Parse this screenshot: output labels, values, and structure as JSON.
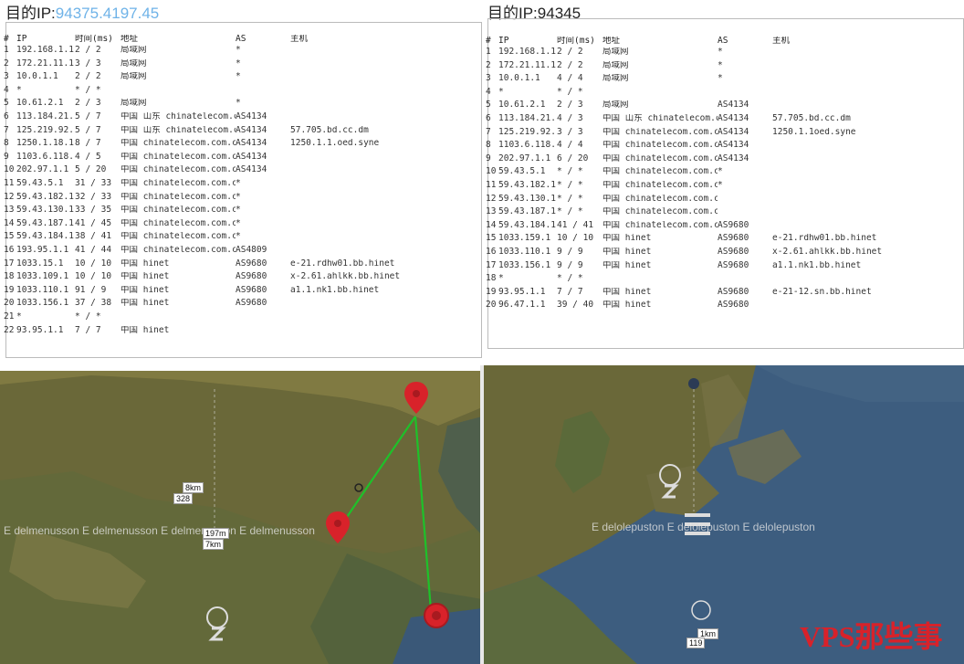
{
  "left": {
    "title_prefix": "目的IP:",
    "title_ip": "94375.4197.45",
    "headers": [
      "#",
      "IP",
      "时间(ms)",
      "地址",
      "AS",
      "主机"
    ],
    "rows": [
      [
        "1",
        "192.168.1.1",
        "2 / 2",
        "局域网",
        "*",
        ""
      ],
      [
        "2",
        "172.21.11.1",
        "3 / 3",
        "局域网",
        "*",
        ""
      ],
      [
        "3",
        "10.0.1.1",
        "2 / 2",
        "局域网",
        "*",
        ""
      ],
      [
        "4",
        "*",
        "* / *",
        "",
        "",
        ""
      ],
      [
        "5",
        "10.61.2.1",
        "2 / 3",
        "局域网",
        "*",
        ""
      ],
      [
        "6",
        "113.184.21.1",
        "5 / 7",
        "中国 山东 chinatelecom.com.cn",
        "AS4134",
        ""
      ],
      [
        "7",
        "125.219.92.1",
        "5 / 7",
        "中国 山东 chinatelecom.com.cn",
        "AS4134",
        "57.705.bd.cc.dm"
      ],
      [
        "8",
        "1250.1.18.1",
        "8 / 7",
        "中国 chinatelecom.com.cn",
        "AS4134",
        "1250.1.1.oed.syne"
      ],
      [
        "9",
        "1103.6.118.1",
        "4 / 5",
        "中国 chinatelecom.com.cn",
        "AS4134",
        ""
      ],
      [
        "10",
        "202.97.1.1",
        "5 / 20",
        "中国 chinatelecom.com.cn",
        "AS4134",
        ""
      ],
      [
        "11",
        "59.43.5.1",
        "31 / 33",
        "中国 chinatelecom.com.cn",
        "*",
        ""
      ],
      [
        "12",
        "59.43.182.1",
        "32 / 33",
        "中国 chinatelecom.com.cn",
        "*",
        ""
      ],
      [
        "13",
        "59.43.130.1",
        "33 / 35",
        "中国 chinatelecom.com.cn",
        "*",
        ""
      ],
      [
        "14",
        "59.43.187.1",
        "41 / 45",
        "中国 chinatelecom.com.cn",
        "*",
        ""
      ],
      [
        "15",
        "59.43.184.1",
        "38 / 41",
        "中国 chinatelecom.com.cn",
        "*",
        ""
      ],
      [
        "16",
        "193.95.1.1",
        "41 / 44",
        "中国 chinatelecom.com.cn",
        "AS4809",
        ""
      ],
      [
        "17",
        "1033.15.1",
        "10 / 10",
        "中国 hinet",
        "AS9680",
        "e-21.rdhw01.bb.hinet"
      ],
      [
        "18",
        "1033.109.1",
        "10 / 10",
        "中国 hinet",
        "AS9680",
        "x-2.61.ahlkk.bb.hinet"
      ],
      [
        "19",
        "1033.110.1",
        "91 / 9",
        "中国 hinet",
        "AS9680",
        "a1.1.nk1.bb.hinet"
      ],
      [
        "20",
        "1033.156.1",
        "37 / 38",
        "中国 hinet",
        "AS9680",
        ""
      ],
      [
        "21",
        "*",
        "* / *",
        "",
        "",
        ""
      ],
      [
        "22",
        "93.95.1.1",
        "7 / 7",
        "中国 hinet",
        "",
        ""
      ]
    ]
  },
  "right": {
    "title_prefix": "目的IP:",
    "title_ip": "94345",
    "headers": [
      "#",
      "IP",
      "时间(ms)",
      "地址",
      "AS",
      "主机"
    ],
    "rows": [
      [
        "1",
        "192.168.1.1",
        "2 / 2",
        "局域网",
        "*",
        ""
      ],
      [
        "2",
        "172.21.11.1",
        "2 / 2",
        "局域网",
        "*",
        ""
      ],
      [
        "3",
        "10.0.1.1",
        "4 / 4",
        "局域网",
        "*",
        ""
      ],
      [
        "4",
        "*",
        "* / *",
        "",
        "",
        ""
      ],
      [
        "5",
        "10.61.2.1",
        "2 / 3",
        "局域网",
        "AS4134",
        ""
      ],
      [
        "6",
        "113.184.21.1",
        "4 / 3",
        "中国 山东 chinatelecom.com.cn",
        "AS4134",
        "57.705.bd.cc.dm"
      ],
      [
        "7",
        "125.219.92.1",
        "3 / 3",
        "中国 chinatelecom.com.cn",
        "AS4134",
        "1250.1.1oed.syne"
      ],
      [
        "8",
        "1103.6.118.1",
        "4 / 4",
        "中国 chinatelecom.com.cn",
        "AS4134",
        ""
      ],
      [
        "9",
        "202.97.1.1",
        "6 / 20",
        "中国 chinatelecom.com.cn",
        "AS4134",
        ""
      ],
      [
        "10",
        "59.43.5.1",
        "* / *",
        "中国 chinatelecom.com.cn",
        "*",
        ""
      ],
      [
        "11",
        "59.43.182.1",
        "* / *",
        "中国 chinatelecom.com.cn",
        "*",
        ""
      ],
      [
        "12",
        "59.43.130.1",
        "* / *",
        "中国 chinatelecom.com.cn",
        "",
        ""
      ],
      [
        "13",
        "59.43.187.1",
        "* / *",
        "中国 chinatelecom.com.cn",
        "",
        ""
      ],
      [
        "14",
        "59.43.184.1",
        "41 / 41",
        "中国 chinatelecom.com.cn",
        "AS9680",
        ""
      ],
      [
        "15",
        "1033.159.1",
        "10 / 10",
        "中国 hinet",
        "AS9680",
        "e-21.rdhw01.bb.hinet"
      ],
      [
        "16",
        "1033.110.1",
        "9 / 9",
        "中国 hinet",
        "AS9680",
        "x-2.61.ahlkk.bb.hinet"
      ],
      [
        "17",
        "1033.156.1",
        "9 / 9",
        "中国 hinet",
        "AS9680",
        "a1.1.nk1.bb.hinet"
      ],
      [
        "18",
        "*",
        "* / *",
        "",
        "",
        ""
      ],
      [
        "19",
        "93.95.1.1",
        "7 / 7",
        "中国 hinet",
        "AS9680",
        "e-21-12.sn.bb.hinet"
      ],
      [
        "20",
        "96.47.1.1",
        "39 / 40",
        "中国 hinet",
        "AS9680",
        ""
      ]
    ]
  },
  "map_left": {
    "distances": [
      "8km",
      "328",
      "197m",
      "7km"
    ],
    "overlay_text": "E delmenusson   E delmenusson   E delmenusson   E delmenusson",
    "colors": {
      "land": "#6b6a3a",
      "sea": "#3a5878",
      "route": "#1ec12a",
      "pin": "#d8222a"
    }
  },
  "map_right": {
    "distances": [
      "1km",
      "119"
    ],
    "overlay_text": "E delolepuston   E delolepuston   E delolepuston",
    "colors": {
      "land": "#6b6a3a",
      "sea": "#3d5d7f"
    }
  },
  "watermark": "VPS那些事"
}
